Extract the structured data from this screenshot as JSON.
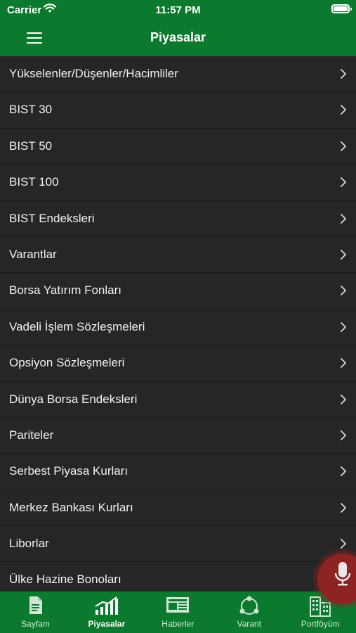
{
  "status_bar": {
    "carrier": "Carrier",
    "time": "11:57 PM"
  },
  "nav": {
    "title": "Piyasalar"
  },
  "list_items": [
    "Yükselenler/Düşenler/Hacimliler",
    "BIST 30",
    "BIST 50",
    "BIST 100",
    "BIST Endeksleri",
    "Varantlar",
    "Borsa Yatırım Fonları",
    "Vadeli İşlem Sözleşmeleri",
    "Opsiyon Sözleşmeleri",
    "Dünya Borsa Endeksleri",
    "Pariteler",
    "Serbest Piyasa Kurları",
    "Merkez Bankası Kurları",
    "Liborlar",
    "Ülke Hazine Bonoları"
  ],
  "tabs": [
    {
      "label": "Sayfam",
      "icon": "document-icon"
    },
    {
      "label": "Piyasalar",
      "icon": "bar-chart-icon",
      "active": true
    },
    {
      "label": "Haberler",
      "icon": "newspaper-icon"
    },
    {
      "label": "Varant",
      "icon": "cycle-icon"
    },
    {
      "label": "Portföyüm",
      "icon": "buildings-icon"
    }
  ],
  "colors": {
    "brand_green": "#0b7a2e",
    "list_bg": "#262626",
    "mic_red": "#8e2323"
  }
}
